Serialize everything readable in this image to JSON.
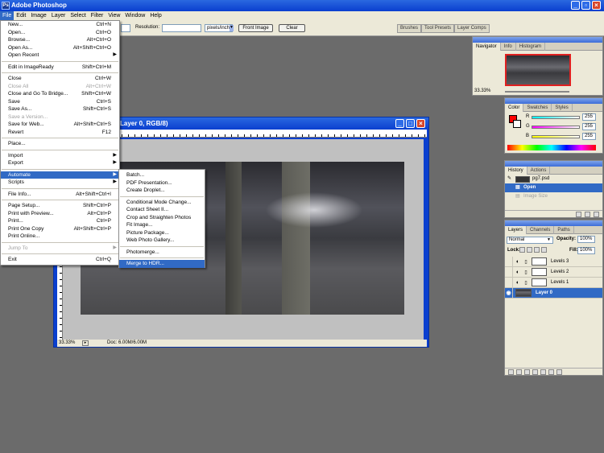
{
  "app": {
    "title": "Adobe Photoshop",
    "logo_text": "Ps"
  },
  "menubar": [
    "File",
    "Edit",
    "Image",
    "Layer",
    "Select",
    "Filter",
    "View",
    "Window",
    "Help"
  ],
  "options": {
    "resolution_label": "Resolution:",
    "unit": "pixels/inch",
    "front_image": "Front Image",
    "clear": "Clear"
  },
  "well_tabs": [
    "Brushes",
    "Tool Presets",
    "Layer Comps"
  ],
  "document": {
    "title": "Layer 0, RGB/8)",
    "zoom": "33.33%",
    "doc_size": "Doc: 6.00M/6.00M"
  },
  "file_menu": [
    {
      "label": "New...",
      "shortcut": "Ctrl+N"
    },
    {
      "label": "Open...",
      "shortcut": "Ctrl+O"
    },
    {
      "label": "Browse...",
      "shortcut": "Alt+Ctrl+O"
    },
    {
      "label": "Open As...",
      "shortcut": "Alt+Shift+Ctrl+O"
    },
    {
      "label": "Open Recent",
      "shortcut": "",
      "submenu": true
    },
    {
      "sep": true
    },
    {
      "label": "Edit in ImageReady",
      "shortcut": "Shift+Ctrl+M"
    },
    {
      "sep": true
    },
    {
      "label": "Close",
      "shortcut": "Ctrl+W"
    },
    {
      "label": "Close All",
      "shortcut": "Alt+Ctrl+W",
      "disabled": true
    },
    {
      "label": "Close and Go To Bridge...",
      "shortcut": "Shift+Ctrl+W"
    },
    {
      "label": "Save",
      "shortcut": "Ctrl+S"
    },
    {
      "label": "Save As...",
      "shortcut": "Shift+Ctrl+S"
    },
    {
      "label": "Save a Version...",
      "shortcut": "",
      "disabled": true
    },
    {
      "label": "Save for Web...",
      "shortcut": "Alt+Shift+Ctrl+S"
    },
    {
      "label": "Revert",
      "shortcut": "F12"
    },
    {
      "sep": true
    },
    {
      "label": "Place...",
      "shortcut": ""
    },
    {
      "sep": true
    },
    {
      "label": "Import",
      "shortcut": "",
      "submenu": true
    },
    {
      "label": "Export",
      "shortcut": "",
      "submenu": true
    },
    {
      "sep": true
    },
    {
      "label": "Automate",
      "shortcut": "",
      "submenu": true,
      "highlight": true
    },
    {
      "label": "Scripts",
      "shortcut": "",
      "submenu": true
    },
    {
      "sep": true
    },
    {
      "label": "File Info...",
      "shortcut": "Alt+Shift+Ctrl+I"
    },
    {
      "sep": true
    },
    {
      "label": "Page Setup...",
      "shortcut": "Shift+Ctrl+P"
    },
    {
      "label": "Print with Preview...",
      "shortcut": "Alt+Ctrl+P"
    },
    {
      "label": "Print...",
      "shortcut": "Ctrl+P"
    },
    {
      "label": "Print One Copy",
      "shortcut": "Alt+Shift+Ctrl+P"
    },
    {
      "label": "Print Online...",
      "shortcut": ""
    },
    {
      "sep": true
    },
    {
      "label": "Jump To",
      "shortcut": "",
      "submenu": true,
      "disabled": true
    },
    {
      "sep": true
    },
    {
      "label": "Exit",
      "shortcut": "Ctrl+Q"
    }
  ],
  "automate_menu": [
    {
      "label": "Batch..."
    },
    {
      "label": "PDF Presentation..."
    },
    {
      "label": "Create Droplet..."
    },
    {
      "sep": true
    },
    {
      "label": "Conditional Mode Change..."
    },
    {
      "label": "Contact Sheet II..."
    },
    {
      "label": "Crop and Straighten Photos"
    },
    {
      "label": "Fit Image..."
    },
    {
      "label": "Picture Package..."
    },
    {
      "label": "Web Photo Gallery..."
    },
    {
      "sep": true
    },
    {
      "label": "Photomerge..."
    },
    {
      "sep": true
    },
    {
      "label": "Merge to HDR...",
      "highlight": true
    }
  ],
  "navigator": {
    "tabs": [
      "Navigator",
      "Info",
      "Histogram"
    ],
    "zoom": "33.33%"
  },
  "color_panel": {
    "tabs": [
      "Color",
      "Swatches",
      "Styles"
    ],
    "channels": [
      {
        "name": "R",
        "value": "255"
      },
      {
        "name": "G",
        "value": "255"
      },
      {
        "name": "B",
        "value": "255"
      }
    ],
    "foreground": "#ff0000"
  },
  "history": {
    "tabs": [
      "History",
      "Actions"
    ],
    "snapshot": "pg7.psd",
    "items": [
      {
        "label": "Open",
        "active": true
      },
      {
        "label": "Image Size",
        "active": false
      }
    ]
  },
  "layers": {
    "tabs": [
      "Layers",
      "Channels",
      "Paths"
    ],
    "blend_mode": "Normal",
    "opacity_label": "Opacity:",
    "opacity": "100%",
    "lock_label": "Lock:",
    "fill_label": "Fill:",
    "fill": "100%",
    "items": [
      {
        "name": "Levels 3",
        "selected": false
      },
      {
        "name": "Levels 2",
        "selected": false
      },
      {
        "name": "Levels 1",
        "selected": false
      },
      {
        "name": "Layer 0",
        "selected": true
      }
    ]
  }
}
